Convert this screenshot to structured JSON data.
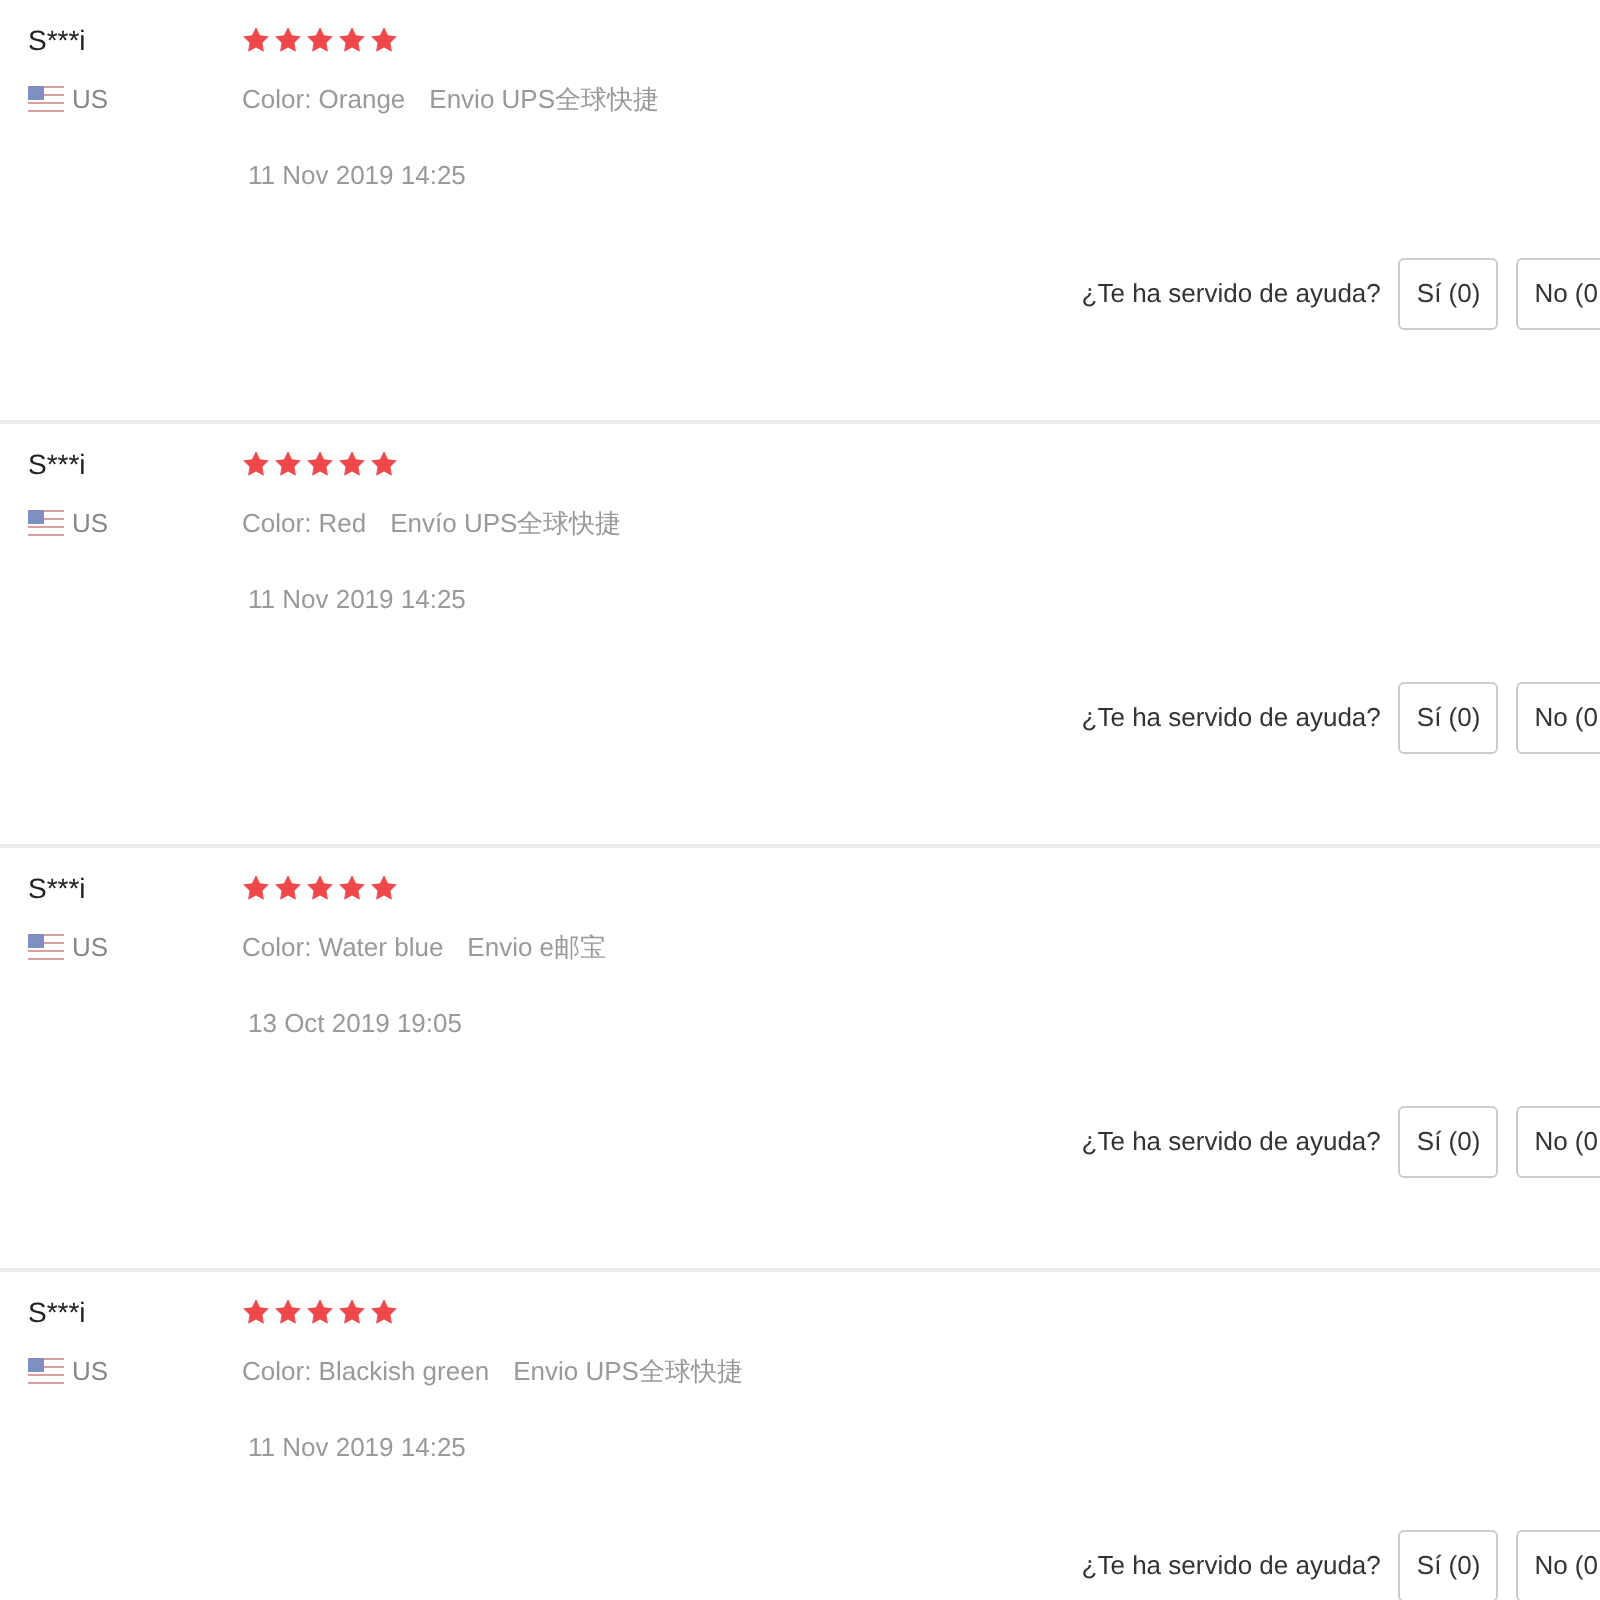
{
  "reviews": [
    {
      "name": "S***i",
      "country": "US",
      "stars": 5,
      "variant": "Color: Orange",
      "shipping": "Envio UPS全球快捷",
      "date": "11 Nov 2019 14:25",
      "helpful": {
        "question": "¿Te ha servido de ayuda?",
        "yes": "Sí (0)",
        "no": "No (0"
      }
    },
    {
      "name": "S***i",
      "country": "US",
      "stars": 5,
      "variant": "Color: Red",
      "shipping": "Envío UPS全球快捷",
      "date": "11 Nov 2019 14:25",
      "helpful": {
        "question": "¿Te ha servido de ayuda?",
        "yes": "Sí (0)",
        "no": "No (0"
      }
    },
    {
      "name": "S***i",
      "country": "US",
      "stars": 5,
      "variant": "Color: Water blue",
      "shipping": "Envio e邮宝",
      "date": "13 Oct 2019 19:05",
      "helpful": {
        "question": "¿Te ha servido de ayuda?",
        "yes": "Sí (0)",
        "no": "No (0"
      }
    },
    {
      "name": "S***i",
      "country": "US",
      "stars": 5,
      "variant": "Color: Blackish green",
      "shipping": "Envio UPS全球快捷",
      "date": "11 Nov 2019 14:25",
      "helpful": {
        "question": "¿Te ha servido de ayuda?",
        "yes": "Sí (0)",
        "no": "No (0"
      }
    }
  ]
}
